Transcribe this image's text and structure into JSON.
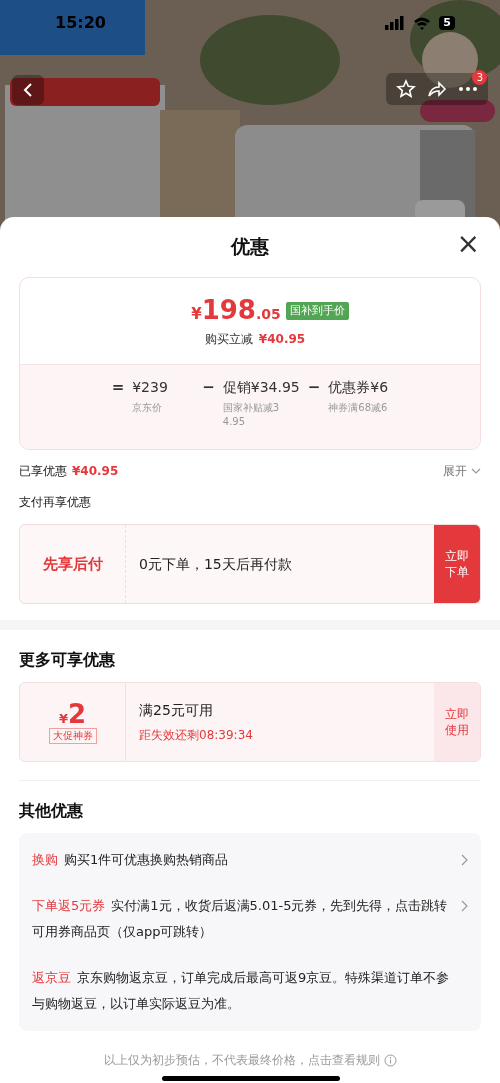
{
  "status_bar": {
    "time": "15:20",
    "battery": "5"
  },
  "top_bar": {
    "badge": "3"
  },
  "sheet": {
    "title": "优惠",
    "close": "×"
  },
  "price_card": {
    "currency": "¥",
    "integer": "198",
    "decimal": ".05",
    "tag": "国补到手价",
    "saving_label": "购买立减",
    "saving_value": "¥40.95",
    "breakdown": [
      {
        "op": "=",
        "amount": "¥239",
        "note": "京东价"
      },
      {
        "op": "−",
        "amount": "促销¥34.95",
        "note": "国家补贴减34.95"
      },
      {
        "op": "−",
        "amount": "优惠券¥6",
        "note": "神券满68减6"
      }
    ]
  },
  "enjoyed": {
    "label": "已享优惠",
    "value": "¥40.95",
    "toggle": "展开"
  },
  "pay_section": {
    "title": "支付再享优惠",
    "name": "先享后付",
    "desc": "0元下单，15天后再付款",
    "button": "立即下单"
  },
  "more_section": {
    "title": "更多可享优惠",
    "coupon": {
      "currency": "¥",
      "amount": "2",
      "tag": "大促神券",
      "condition": "满25元可用",
      "countdown": "距失效还剩08:39:34",
      "button": "立即使用"
    }
  },
  "other_section": {
    "title": "其他优惠",
    "items": [
      {
        "tag": "换购",
        "text": "购买1件可优惠换购热销商品",
        "arrow": true
      },
      {
        "tag": "下单返5元券",
        "text": "实付满1元，收货后返满5.01-5元券，先到先得，点击跳转可用券商品页（仅app可跳转）",
        "arrow": true
      },
      {
        "tag": "返京豆",
        "text": "京东购物返京豆，订单完成后最高可返9京豆。特殊渠道订单不参与购物返豆，以订单实际返豆为准。",
        "arrow": false
      }
    ]
  },
  "footnote": "以上仅为初步预估，不代表最终价格，点击查看规则"
}
